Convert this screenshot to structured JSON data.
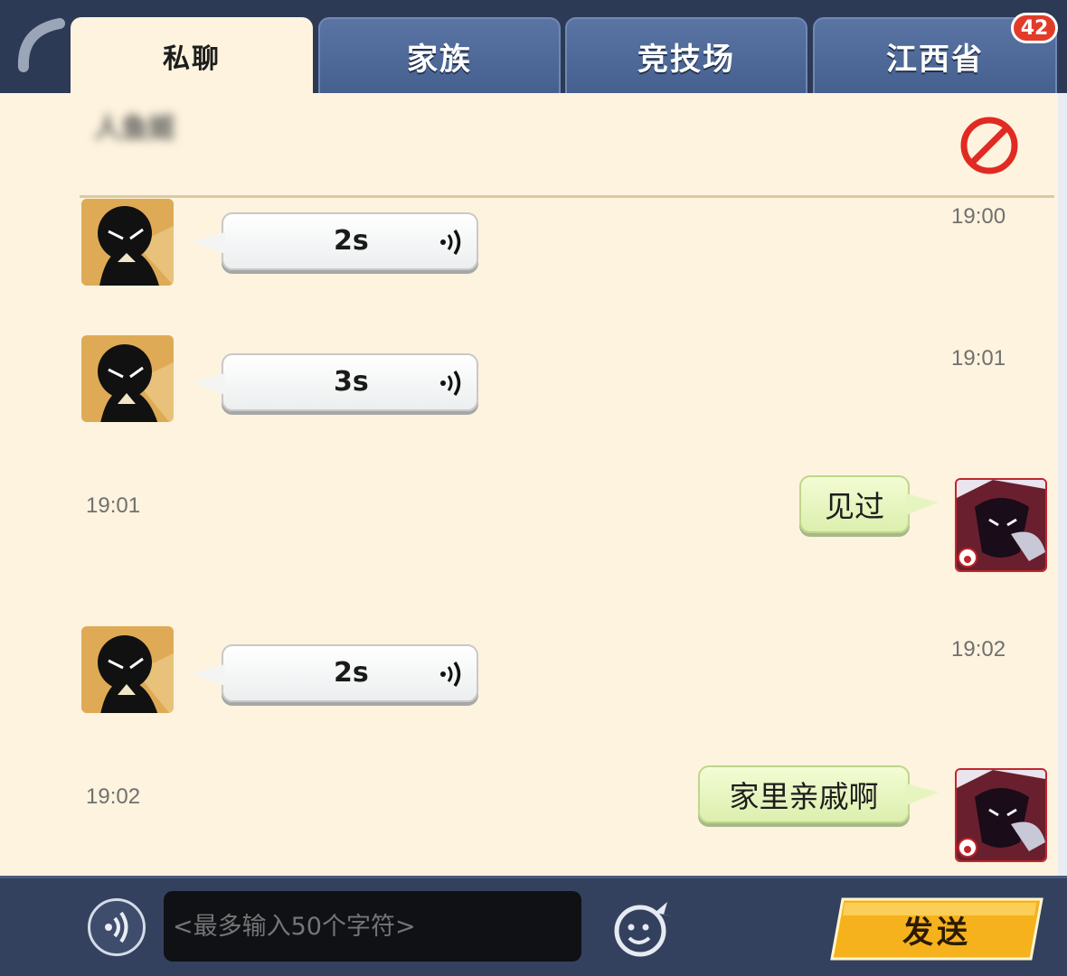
{
  "tabs": [
    {
      "label": "私聊",
      "active": true
    },
    {
      "label": "家族",
      "active": false
    },
    {
      "label": "竞技场",
      "active": false
    },
    {
      "label": "江西省",
      "active": false
    }
  ],
  "badge_count": "42",
  "conversation": {
    "contact_name": "人鱼姬",
    "messages": [
      {
        "side": "left",
        "type": "voice",
        "duration": "2s",
        "time": "19:00"
      },
      {
        "side": "left",
        "type": "voice",
        "duration": "3s",
        "time": "19:01"
      },
      {
        "side": "right",
        "type": "text",
        "text": "见过",
        "time": "19:01"
      },
      {
        "side": "left",
        "type": "voice",
        "duration": "2s",
        "time": "19:02"
      },
      {
        "side": "right",
        "type": "text",
        "text": "家里亲戚啊",
        "time": "19:02"
      }
    ]
  },
  "input": {
    "placeholder": "<最多输入50个字符>"
  },
  "send_label": "发送",
  "colors": {
    "panel_bg": "#fdf3de",
    "tab_bg": "#4f6a98",
    "send_btn": "#f6b21c",
    "self_bubble": "#e6f5c0"
  },
  "icons": [
    "back-arc-icon",
    "block-icon",
    "voice-wave-icon",
    "mic-icon",
    "emoji-icon"
  ]
}
